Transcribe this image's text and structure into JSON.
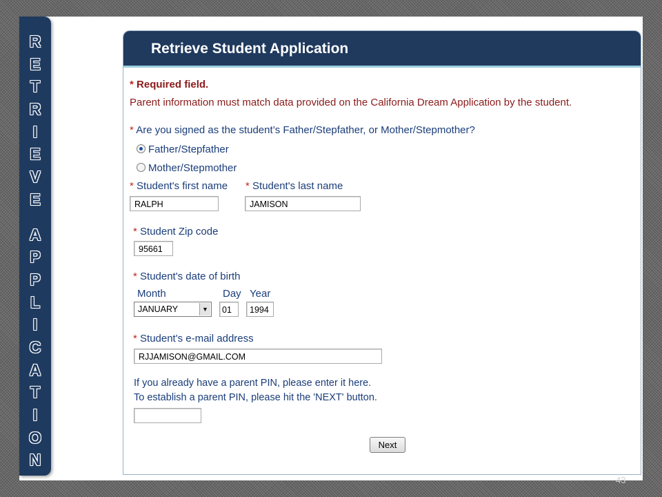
{
  "side_title": [
    "R",
    "E",
    "T",
    "R",
    "I",
    "E",
    "V",
    "E",
    "",
    "A",
    "P",
    "P",
    "L",
    "I",
    "C",
    "A",
    "T",
    "I",
    "O",
    "N"
  ],
  "header": {
    "title": "Retrieve Student Application"
  },
  "required_note": {
    "star": "*",
    "label": "Required field."
  },
  "info_text": "Parent information must match data provided on the California Dream Application by the student.",
  "relationship": {
    "question": "Are you signed as the student’s Father/Stepfather, or Mother/Stepmother?",
    "options": [
      {
        "label": "Father/Stepfather",
        "selected": true
      },
      {
        "label": "Mother/Stepmother",
        "selected": false
      }
    ]
  },
  "first_name": {
    "label": "Student's first name",
    "value": "RALPH"
  },
  "last_name": {
    "label": "Student's last name",
    "value": "JAMISON"
  },
  "zip": {
    "label": "Student Zip code",
    "value": "95661"
  },
  "dob": {
    "label": "Student's date of birth",
    "month_label": "Month",
    "day_label": "Day",
    "year_label": "Year",
    "month_value": "JANUARY",
    "day_value": "01",
    "year_value": "1994",
    "dropdown_arrow": "▼"
  },
  "email": {
    "label": "Student's e-mail address",
    "value": "RJJAMISON@GMAIL.COM"
  },
  "pin": {
    "line1": "If you already have a parent PIN, please enter it here.",
    "line2": "To establish a parent PIN, please hit the 'NEXT' button.",
    "value": ""
  },
  "next_button": {
    "label": "Next"
  },
  "slide_number": "43"
}
